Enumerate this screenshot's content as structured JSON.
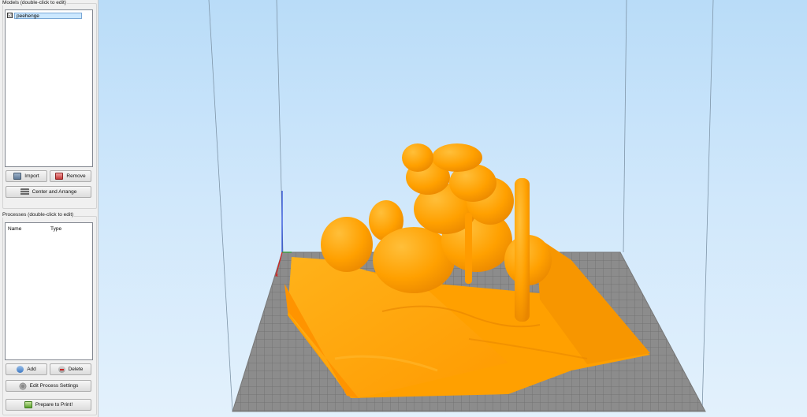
{
  "models_panel": {
    "title": "Models (double-click to edit)",
    "items": [
      {
        "name": "peehenge",
        "checked": "☑"
      }
    ],
    "import_label": "Import",
    "remove_label": "Remove",
    "center_arrange_label": "Center and Arrange"
  },
  "processes_panel": {
    "title": "Processes (double-click to edit)",
    "columns": [
      "Name",
      "Type"
    ],
    "add_label": "Add",
    "delete_label": "Delete",
    "edit_label": "Edit Process Settings",
    "prepare_label": "Prepare to Print!"
  },
  "viewport": {
    "sky_color": "#c6e2fa",
    "bed_color": "#8c8c8c",
    "grid_color": "#6e6e6e",
    "model_color": "#ffa100",
    "model_shadow_color": "#e07e00"
  }
}
